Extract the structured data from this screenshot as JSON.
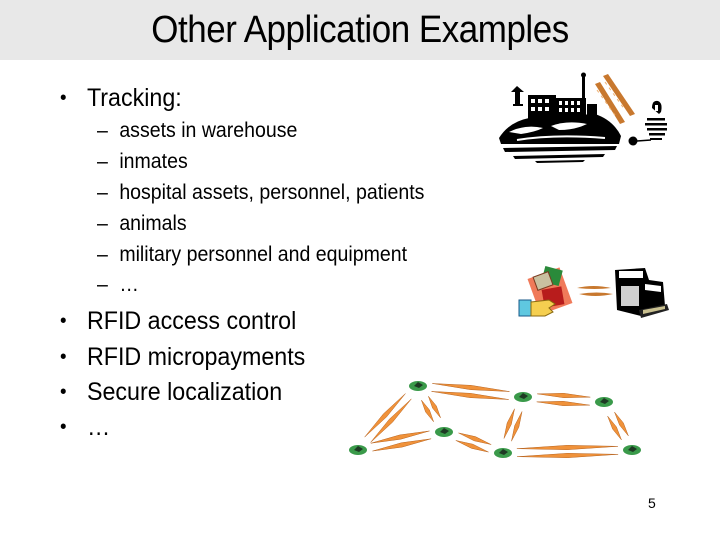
{
  "slide": {
    "title": "Other Application Examples",
    "page_number": "5",
    "bullets": [
      {
        "label": "Tracking:",
        "sub_items": [
          "assets in warehouse",
          "inmates",
          "hospital assets, personnel, patients",
          "animals",
          "military personnel and equipment",
          "…"
        ]
      },
      {
        "label": "RFID access control"
      },
      {
        "label": "RFID micropayments"
      },
      {
        "label": "Secure localization"
      },
      {
        "label": "…"
      }
    ],
    "bullet_glyph": "•",
    "dash_glyph": "–"
  },
  "illustrations": {
    "tracking": {
      "icon": "prison-island-tracking-clipart",
      "accent_color": "#c8782e"
    },
    "micropayment": {
      "icon": "card-to-register-payment-clipart",
      "accent_color": "#c8782e"
    },
    "localization": {
      "icon": "sensor-network-clipart",
      "node_color": "#3a9a4a",
      "link_color": "#f0923a",
      "node_count": 7,
      "link_count": 9
    }
  }
}
